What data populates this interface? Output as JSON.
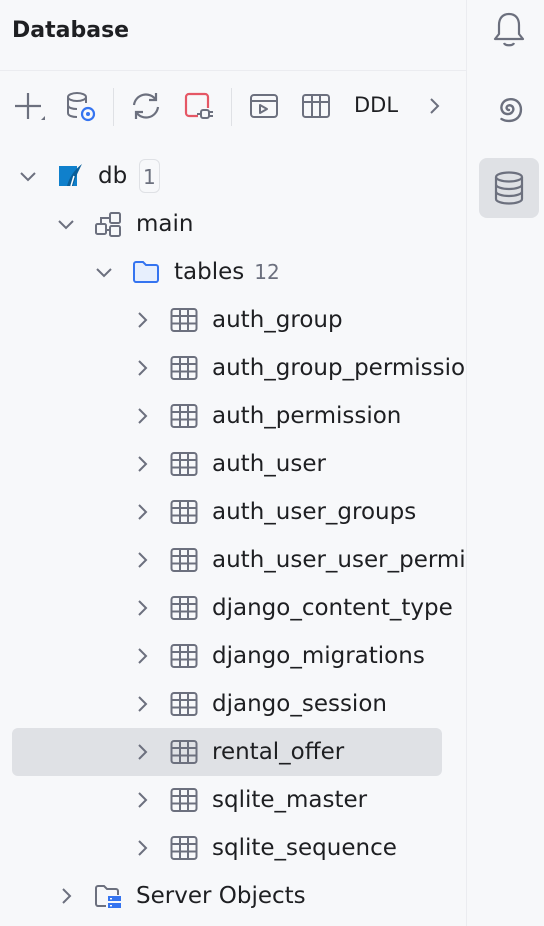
{
  "panel": {
    "title": "Database"
  },
  "toolbar": {
    "ddl_label": "DDL"
  },
  "tree": {
    "datasource": {
      "label": "db",
      "badge": "1"
    },
    "schema": {
      "label": "main"
    },
    "tables_folder": {
      "label": "tables",
      "count": "12"
    },
    "tables": [
      "auth_group",
      "auth_group_permissions",
      "auth_permission",
      "auth_user",
      "auth_user_groups",
      "auth_user_user_permissions",
      "django_content_type",
      "django_migrations",
      "django_session",
      "rental_offer",
      "sqlite_master",
      "sqlite_sequence"
    ],
    "selected_table": "rental_offer",
    "server_objects": {
      "label": "Server Objects"
    }
  },
  "sidebar": {
    "active": "database-icon"
  },
  "colors": {
    "accent": "#3574f0",
    "danger": "#e55765",
    "selection": "#dfe1e5",
    "icon": "#6c707e"
  }
}
